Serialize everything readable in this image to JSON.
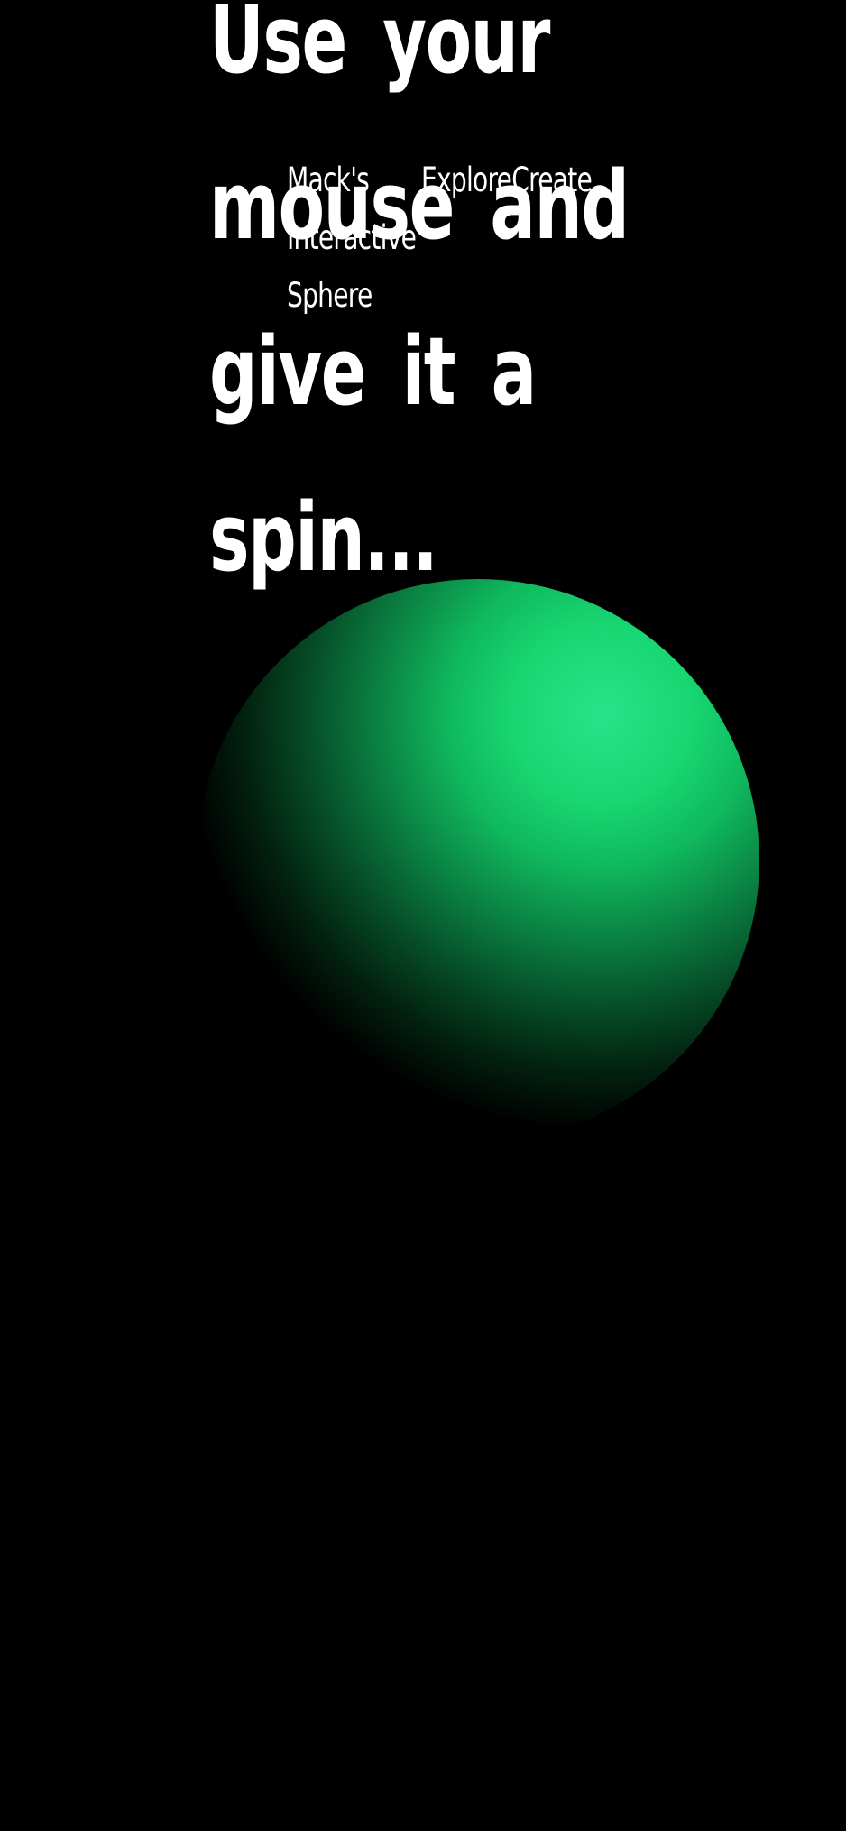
{
  "brand": {
    "line1": "Mack's",
    "line2": "Interactive",
    "line3": "Sphere"
  },
  "nav": {
    "explore": "Explore",
    "create": "Create"
  },
  "headline": {
    "line1": "Use your",
    "line2": "mouse and",
    "line3": "give it a",
    "line4": "spin..."
  },
  "colors": {
    "background": "#000000",
    "sphere_highlight": "#18d772",
    "text": "#ffffff"
  }
}
